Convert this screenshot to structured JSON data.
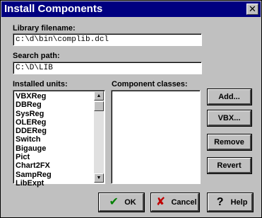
{
  "window": {
    "title": "Install Components",
    "close_glyph": "✕"
  },
  "library": {
    "label": "Library filename:",
    "value": "c:\\d\\bin\\complib.dcl"
  },
  "search": {
    "label": "Search path:",
    "value": "C:\\D\\LIB"
  },
  "installed": {
    "label": "Installed units:",
    "items": [
      "VBXReg",
      "DBReg",
      "SysReg",
      "OLEReg",
      "DDEReg",
      "Switch",
      "Bigauge",
      "Pict",
      "Chart2FX",
      "SampReg",
      "LibExpt"
    ]
  },
  "classes": {
    "label": "Component classes:",
    "items": []
  },
  "buttons": {
    "add": "Add...",
    "vbx": "VBX...",
    "remove": "Remove",
    "revert": "Revert",
    "ok": "OK",
    "cancel": "Cancel",
    "help": "Help"
  },
  "icons": {
    "ok": "check-icon",
    "cancel": "x-icon",
    "help": "question-icon"
  }
}
